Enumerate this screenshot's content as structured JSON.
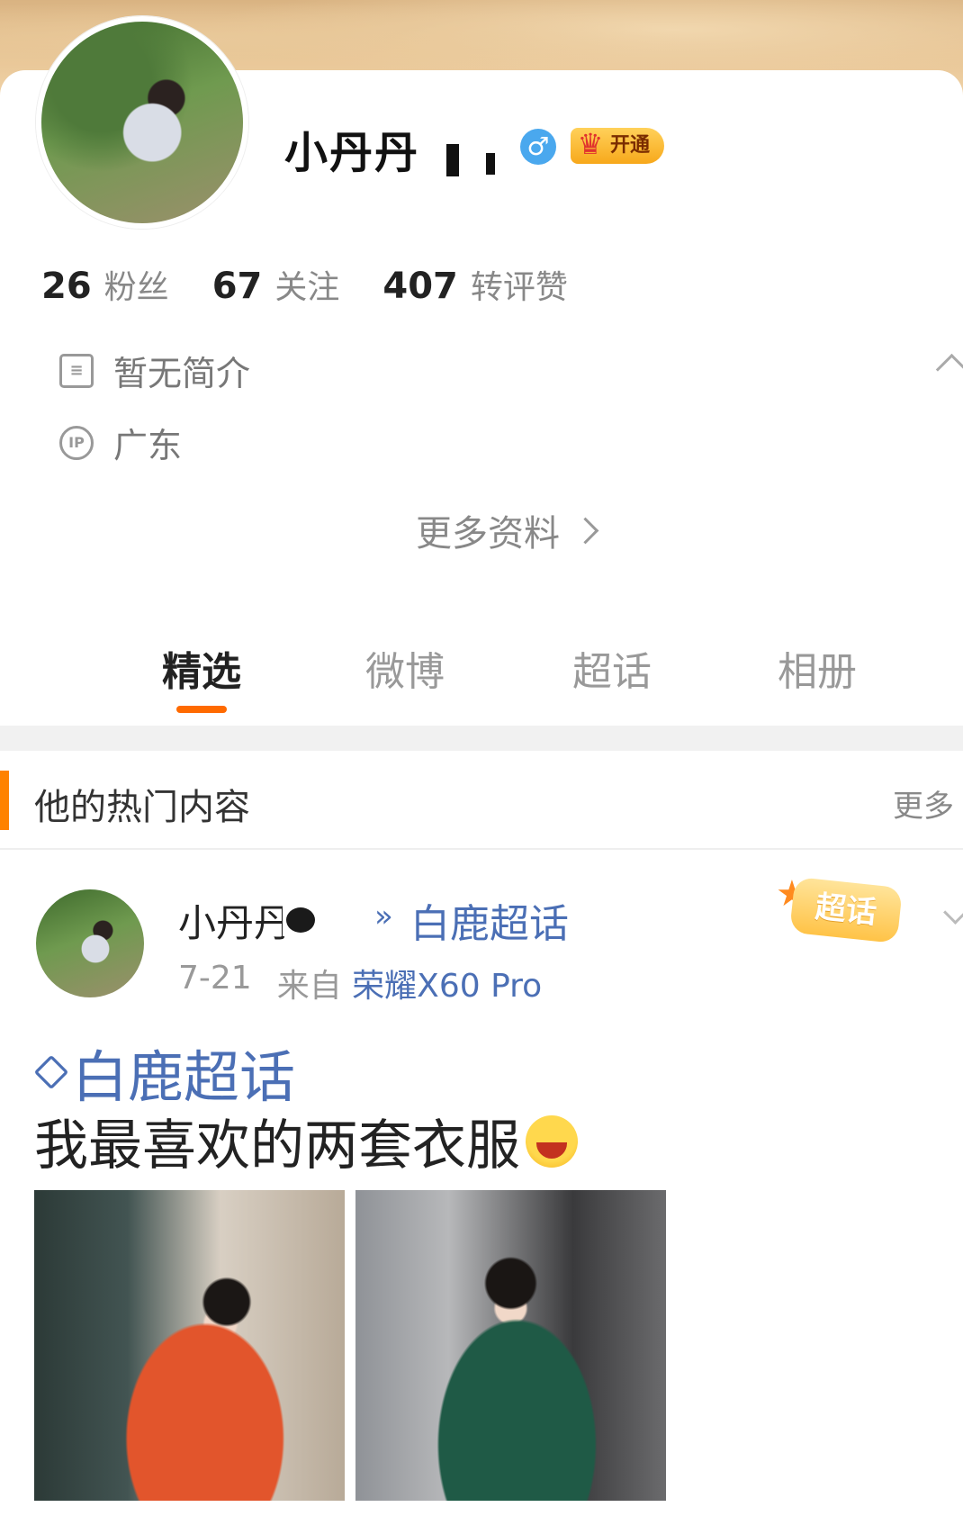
{
  "profile": {
    "username": "小丹丹",
    "gender_icon": "male-icon",
    "vip_label": "开通",
    "stats": [
      {
        "value": "26",
        "label": "粉丝"
      },
      {
        "value": "67",
        "label": "关注"
      },
      {
        "value": "407",
        "label": "转评赞"
      }
    ],
    "bio": "暂无简介",
    "ip_icon_text": "IP",
    "ip_location": "广东",
    "more_info": "更多资料"
  },
  "tabs": [
    {
      "label": "精选",
      "active": true
    },
    {
      "label": "微博",
      "active": false
    },
    {
      "label": "超话",
      "active": false
    },
    {
      "label": "相册",
      "active": false
    }
  ],
  "hot_section": {
    "title": "他的热门内容",
    "more": "更多"
  },
  "post": {
    "username": "小丹丹",
    "topic_link": "白鹿超话",
    "date": "7-21",
    "source_prefix": "来自",
    "device": "荣耀X60 Pro",
    "badge": "超话",
    "topic": "白鹿超话",
    "text": "我最喜欢的两套衣服"
  },
  "colors": {
    "accent_orange": "#ff8200",
    "link_blue": "#4b6fb5",
    "gender_blue": "#4aa8ee"
  }
}
